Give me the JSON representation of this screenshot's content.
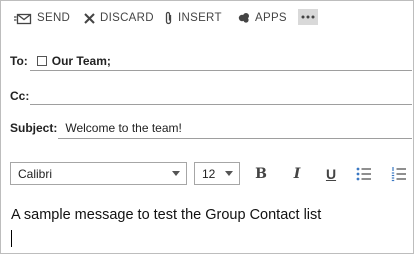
{
  "toolbar": {
    "send_label": "SEND",
    "discard_label": "DISCARD",
    "insert_label": "INSERT",
    "apps_label": "APPS"
  },
  "recipients": {
    "to_label": "To:",
    "to_value": "Our Team;",
    "cc_label": "Cc:",
    "subject_label": "Subject:",
    "subject_value": "Welcome to the team!"
  },
  "format": {
    "font": "Calibri",
    "size": "12",
    "bold": "B",
    "italic": "I",
    "underline": "U"
  },
  "message": {
    "body": "A sample message to test the Group Contact list"
  },
  "colors": {
    "icon": "#444444",
    "more_button_bg": "#d9d9d9",
    "list_icon_accent": "#3a78c3"
  }
}
